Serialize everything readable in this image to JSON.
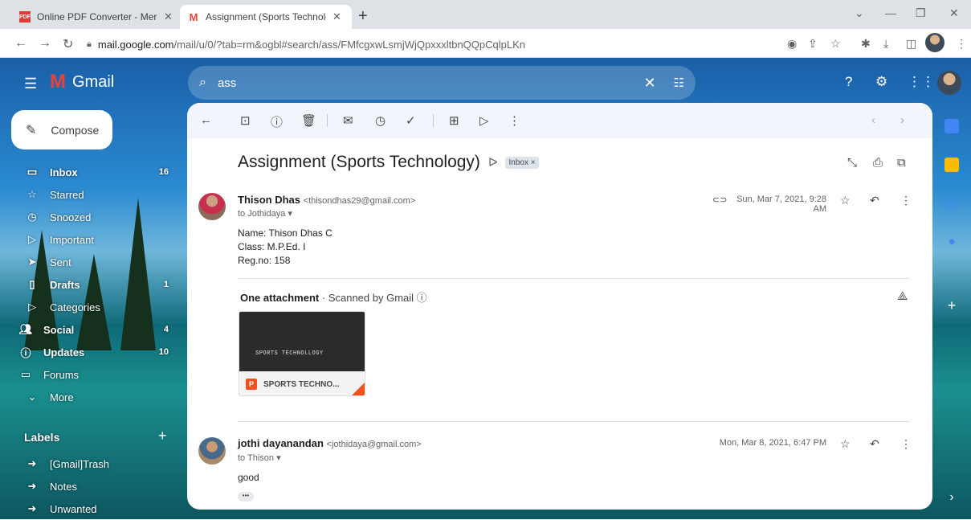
{
  "browser": {
    "tabs": [
      {
        "title": "Online PDF Converter - Merge, c",
        "icon": "pdf-icon",
        "active": false
      },
      {
        "title": "Assignment (Sports Technology)",
        "icon": "gmail-icon",
        "active": true
      }
    ],
    "url_host": "mail.google.com",
    "url_path": "/mail/u/0/?tab=rm&ogbl#search/ass/FMfcgxwLsmjWjQpxxxltbnQQpCqlpLKn"
  },
  "gmail": {
    "app_name": "Gmail",
    "search_value": "ass",
    "compose_label": "Compose"
  },
  "sidebar": {
    "items": [
      {
        "label": "Inbox",
        "count": "16",
        "icon": "inbox-icon"
      },
      {
        "label": "Starred",
        "count": "",
        "icon": "star-icon"
      },
      {
        "label": "Snoozed",
        "count": "",
        "icon": "clock-icon"
      },
      {
        "label": "Important",
        "count": "",
        "icon": "important-icon"
      },
      {
        "label": "Sent",
        "count": "",
        "icon": "send-icon"
      },
      {
        "label": "Drafts",
        "count": "1",
        "icon": "draft-icon"
      },
      {
        "label": "Categories",
        "count": "",
        "icon": "label-icon"
      },
      {
        "label": "Social",
        "count": "4",
        "icon": "people-icon"
      },
      {
        "label": "Updates",
        "count": "10",
        "icon": "info-icon"
      },
      {
        "label": "Forums",
        "count": "",
        "icon": "forum-icon"
      },
      {
        "label": "More",
        "count": "",
        "icon": "chevron-down-icon"
      }
    ],
    "labels_heading": "Labels",
    "labels": [
      "[Gmail]Trash",
      "Notes",
      "Unwanted"
    ]
  },
  "email": {
    "subject": "Assignment (Sports Technology)",
    "badge": "Inbox ×",
    "messages": [
      {
        "sender": "Thison Dhas",
        "email": "<thisondhas29@gmail.com>",
        "to": "to Jothidaya ▾",
        "date": "Sun, Mar 7, 2021, 9:28 AM",
        "body": [
          "Name: Thison Dhas C",
          "Class: M.P.Ed.   I",
          "Reg.no: 158"
        ]
      },
      {
        "sender": "jothi dayanandan",
        "email": "<jothidaya@gmail.com>",
        "to": "to Thison ▾",
        "date": "Mon, Mar 8, 2021, 6:47 PM",
        "body": [
          "good"
        ]
      }
    ],
    "attachment_heading": "One attachment",
    "attachment_scan": "· Scanned by Gmail ⓘ",
    "attachment_name": "SPORTS TECHNO...",
    "attachment_preview_text": "SPORTS TECHNOLLOGY",
    "ellipsis": "•••"
  },
  "colors": {
    "accent": "#0b57d0",
    "gmail_red": "#ea4335",
    "ppt": "#f4511e"
  }
}
